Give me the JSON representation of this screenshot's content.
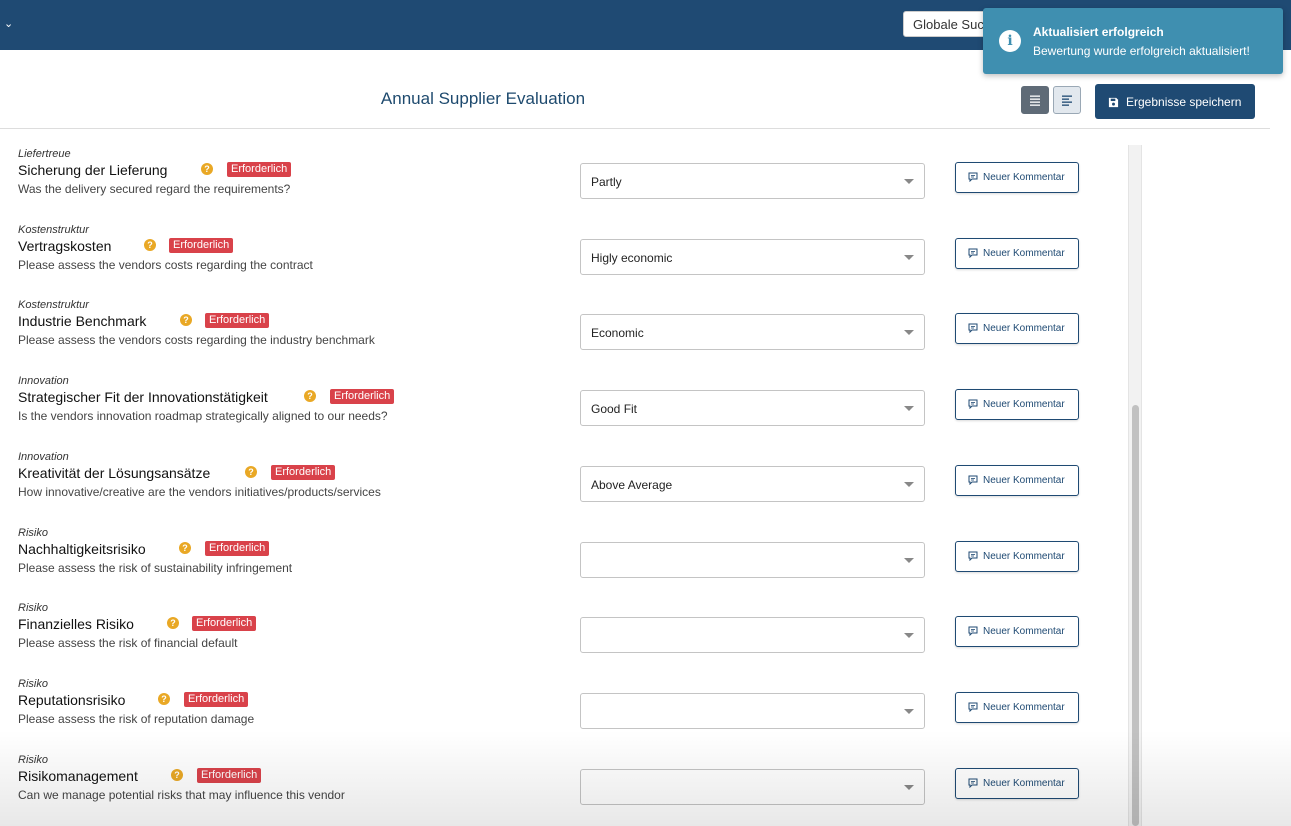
{
  "header": {
    "search_placeholder": "Globale Suche"
  },
  "toast": {
    "title": "Aktualisiert erfolgreich",
    "message": "Bewertung wurde erfolgreich aktualisiert!"
  },
  "page": {
    "title": "Annual Supplier Evaluation",
    "save_label": "Ergebnisse speichern"
  },
  "labels": {
    "required": "Erforderlich",
    "new_comment": "Neuer Kommentar"
  },
  "questions": [
    {
      "category": "Liefertreue",
      "title": "Sicherung der Lieferung",
      "description": "Was the delivery secured regard the requirements?",
      "value": "Partly"
    },
    {
      "category": "Kostenstruktur",
      "title": "Vertragskosten",
      "description": "Please assess the vendors costs regarding the contract",
      "value": "Higly economic"
    },
    {
      "category": "Kostenstruktur",
      "title": "Industrie Benchmark",
      "description": "Please assess the vendors costs regarding the industry benchmark",
      "value": "Economic"
    },
    {
      "category": "Innovation",
      "title": "Strategischer Fit der Innovationstätigkeit",
      "description": "Is the vendors innovation roadmap strategically aligned to our needs?",
      "value": "Good Fit"
    },
    {
      "category": "Innovation",
      "title": "Kreativität der Lösungsansätze",
      "description": "How innovative/creative are the vendors initiatives/products/services",
      "value": "Above Average"
    },
    {
      "category": "Risiko",
      "title": "Nachhaltigkeitsrisiko",
      "description": "Please assess the risk of sustainability infringement",
      "value": ""
    },
    {
      "category": "Risiko",
      "title": "Finanzielles Risiko",
      "description": "Please assess the risk of financial default",
      "value": ""
    },
    {
      "category": "Risiko",
      "title": "Reputationsrisiko",
      "description": "Please assess the risk of reputation damage",
      "value": ""
    },
    {
      "category": "Risiko",
      "title": "Risikomanagement",
      "description": "Can we manage potential risks that may influence this vendor",
      "value": ""
    }
  ]
}
